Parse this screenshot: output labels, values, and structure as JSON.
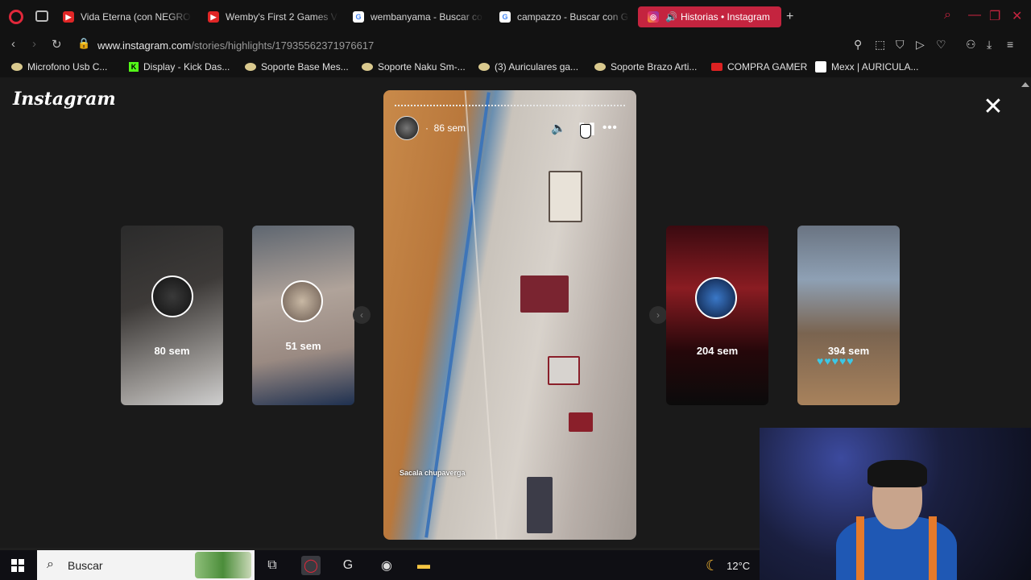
{
  "browser": {
    "tabs": [
      {
        "label": "Vida Eterna (con NEGRO I",
        "icon": "youtube-icon"
      },
      {
        "label": "Wemby's First 2 Games V",
        "icon": "youtube-icon"
      },
      {
        "label": "wembanyama - Buscar co",
        "icon": "google-icon"
      },
      {
        "label": "campazzo - Buscar con G",
        "icon": "google-icon"
      },
      {
        "label": "Historias • Instagram",
        "icon": "instagram-icon",
        "active": true
      }
    ],
    "new_tab_label": "+",
    "url_domain": "www.instagram.com",
    "url_path": "/stories/highlights/17935562371976617"
  },
  "bookmarks": [
    {
      "label": "Microfono Usb C...",
      "icon": "bookmark-generic"
    },
    {
      "label": "Display - Kick Das...",
      "icon": "kick-icon"
    },
    {
      "label": "Soporte Base Mes...",
      "icon": "bookmark-generic"
    },
    {
      "label": "Soporte Naku Sm-...",
      "icon": "bookmark-generic"
    },
    {
      "label": "(3) Auriculares ga...",
      "icon": "bookmark-generic"
    },
    {
      "label": "Soporte Brazo Arti...",
      "icon": "bookmark-generic"
    },
    {
      "label": "COMPRA GAMER",
      "icon": "compragamer-icon"
    },
    {
      "label": "Mexx | AURICULA...",
      "icon": "mexx-icon"
    }
  ],
  "instagram": {
    "logo": "Instagram",
    "story": {
      "time_label": "86 sem",
      "separator": "·",
      "caption": "Sacala chupaverga"
    },
    "previews": [
      {
        "label": "80 sem"
      },
      {
        "label": "51 sem"
      },
      {
        "label": "204 sem"
      },
      {
        "label": "394 sem"
      }
    ]
  },
  "taskbar": {
    "search_placeholder": "Buscar",
    "temperature": "12°C"
  },
  "colors": {
    "accent": "#c4243f",
    "background": "#1a1a1a",
    "hearts": "#3cc8e6"
  }
}
